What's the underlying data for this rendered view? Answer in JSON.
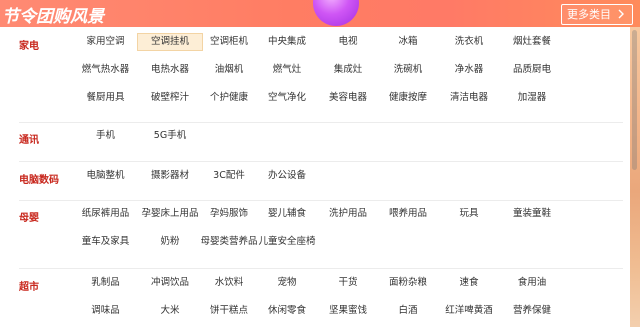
{
  "banner": {
    "logo_text": "节令团购风景",
    "more_button_label": "更多类目"
  },
  "sections": [
    {
      "title": "家电",
      "rows": [
        [
          "家用空调",
          "空调挂机",
          "空调柜机",
          "中央集成",
          "电视",
          "冰箱",
          "洗衣机",
          "烟灶套餐"
        ],
        [
          "燃气热水器",
          "电热水器",
          "油烟机",
          "燃气灶",
          "集成灶",
          "洗碗机",
          "净水器",
          "品质厨电"
        ],
        [
          "餐厨用具",
          "破壁榨汁",
          "个护健康",
          "空气净化",
          "美容电器",
          "健康按摩",
          "清洁电器",
          "加湿器"
        ]
      ],
      "active_item": "空调挂机"
    },
    {
      "title": "通讯",
      "rows": [
        [
          "手机",
          "5G手机"
        ]
      ]
    },
    {
      "title": "电脑数码",
      "rows": [
        [
          "电脑整机",
          "摄影器材",
          "3C配件",
          "办公设备"
        ]
      ]
    },
    {
      "title": "母婴",
      "rows": [
        [
          "纸尿裤用品",
          "孕婴床上用品",
          "孕妈服饰",
          "婴儿辅食",
          "洗护用品",
          "喂养用品",
          "玩具",
          "童装童鞋"
        ],
        [
          "童车及家具",
          "奶粉",
          "母婴类营养品",
          "儿童安全座椅"
        ]
      ]
    },
    {
      "title": "超市",
      "rows": [
        [
          "乳制品",
          "冲调饮品",
          "水饮料",
          "宠物",
          "干货",
          "面粉杂粮",
          "速食",
          "食用油"
        ],
        [
          "调味品",
          "大米",
          "饼干糕点",
          "休闲零食",
          "坚果蜜饯",
          "白酒",
          "红洋啤黄酒",
          "营养保健"
        ]
      ]
    }
  ],
  "colors": {
    "banner": "#ff7d63",
    "section_title": "#c8281e",
    "active_bg": "#fdeed6"
  }
}
